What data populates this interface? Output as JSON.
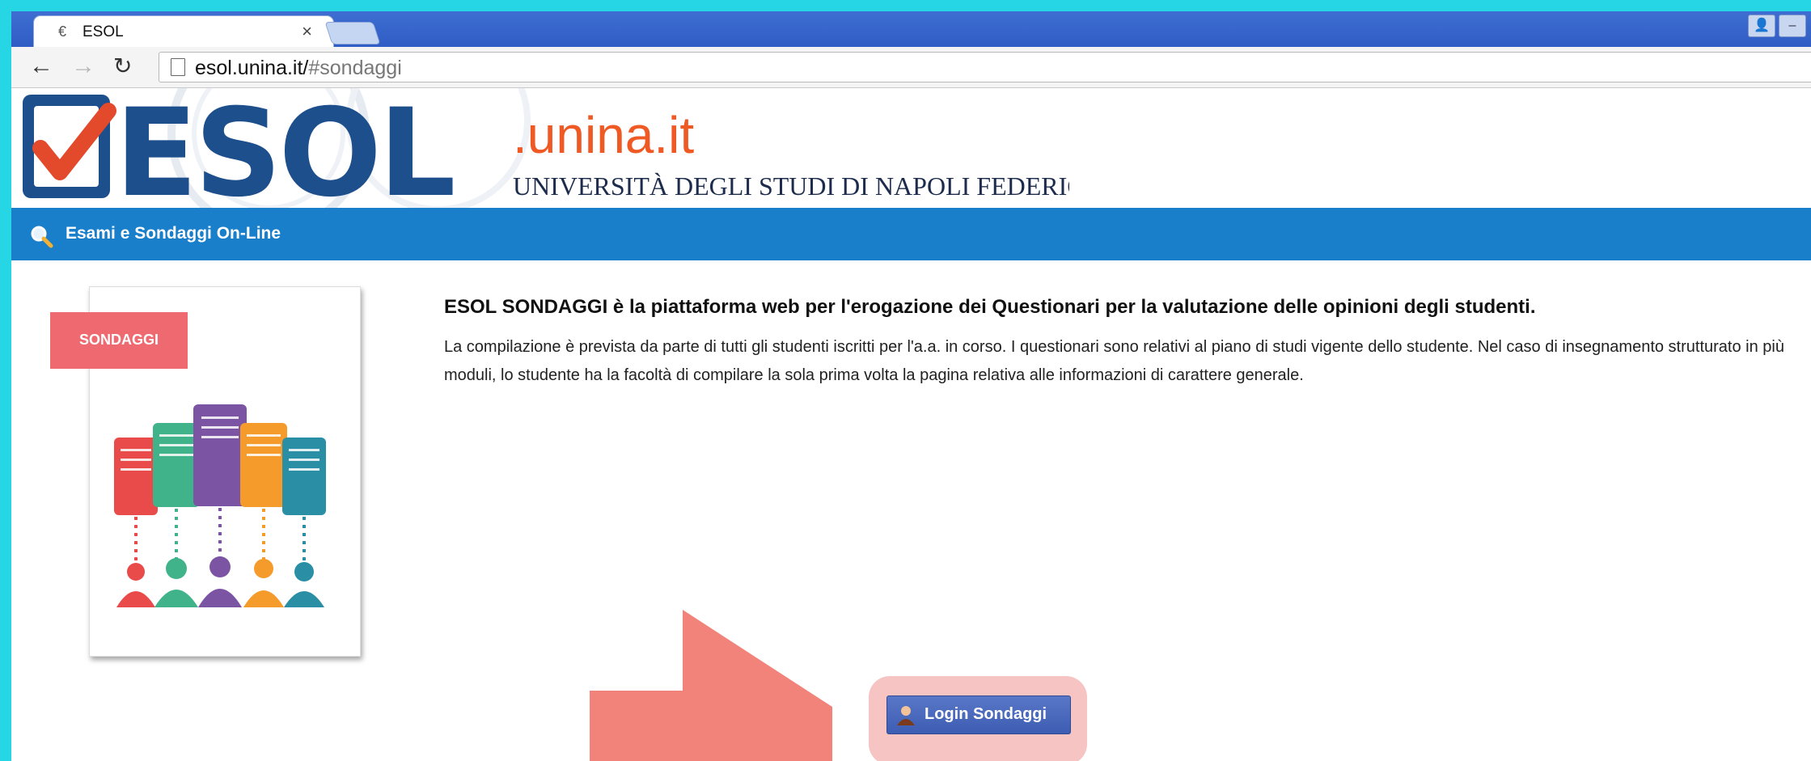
{
  "browser": {
    "tab_title": "ESOL",
    "tab_close": "×",
    "url_host": "esol.unina.it/",
    "url_path": "#sondaggi",
    "window_buttons": [
      "👤",
      "–"
    ]
  },
  "header": {
    "logo_text": "ESOL",
    "domain": ".unina.it",
    "university": "UNIVERSITÀ DEGLI STUDI DI NAPOLI FEDERICO II"
  },
  "banner": {
    "text": "Esami e Sondaggi On-Line"
  },
  "illustration": {
    "tag_label": "SONDAGGI"
  },
  "main": {
    "heading": "ESOL SONDAGGI è la piattaforma web per l'erogazione dei Questionari per la valutazione delle opinioni degli studenti.",
    "description": "La compilazione è prevista da parte di tutti gli studenti iscritti per l'a.a. in corso. I questionari sono relativi al piano di studi vigente dello studente. Nel caso di insegnamento strutturato in più moduli, lo studente ha la facoltà di compilare la sola prima volta la pagina relativa alle informazioni di carattere generale."
  },
  "login": {
    "label": "Login Sondaggi"
  },
  "colors": {
    "frame": "#27d6e4",
    "banner": "#1a7fcb",
    "logo_blue": "#1d4f8d",
    "check_red": "#e34a2c",
    "domain_orange": "#ef5a24",
    "arrow": "#f2837a",
    "login_button": "#4a68bd"
  }
}
